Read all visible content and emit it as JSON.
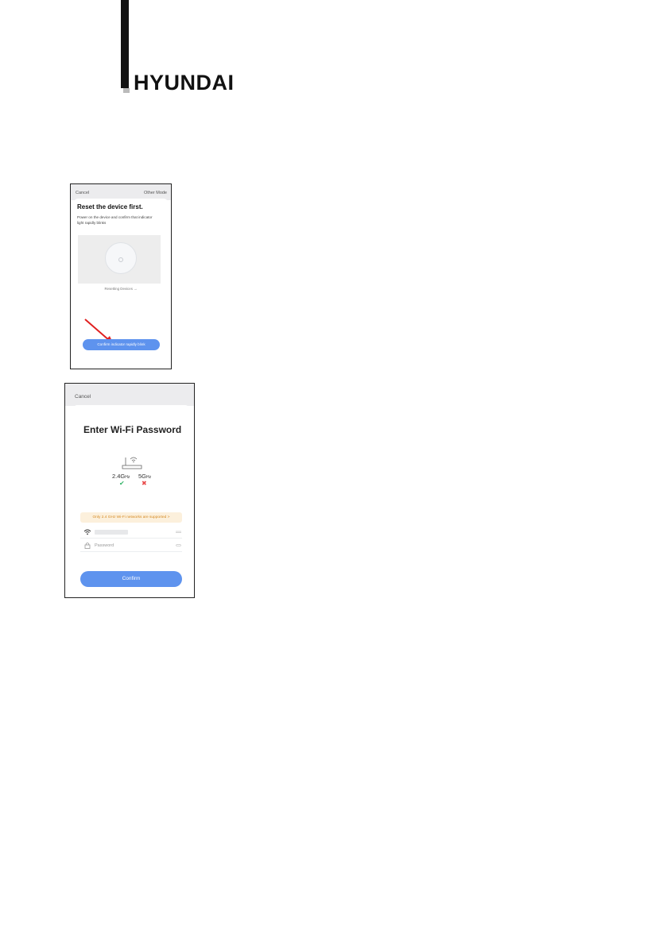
{
  "brand": {
    "name": "HYUNDAI"
  },
  "screenshot_reset": {
    "cancel_label": "Cancel",
    "other_mode_label": "Other Mode",
    "heading": "Reset the device first.",
    "instructions": "Power on the device and confirm that indicator light rapidly blinks",
    "illustration_caption": "Resetting Devices →",
    "confirm_button": "Confirm indicator rapidly blink",
    "arrow_color": "#e02020",
    "button_color": "#5e93ee"
  },
  "screenshot_wifi": {
    "cancel_label": "Cancel",
    "heading": "Enter Wi-Fi Password",
    "band_24": "2.4G",
    "band_24_unit": "Hz",
    "band_5": "5G",
    "band_5_unit": "Hz",
    "band_24_supported_icon": "check-icon",
    "band_5_supported_icon": "cross-icon",
    "notice": "Only 2.4 GHz Wi-Fi networks are supported >",
    "password_placeholder": "Password",
    "confirm_button": "Confirm",
    "notice_color": "#d58a24",
    "button_color": "#5e93ee"
  }
}
